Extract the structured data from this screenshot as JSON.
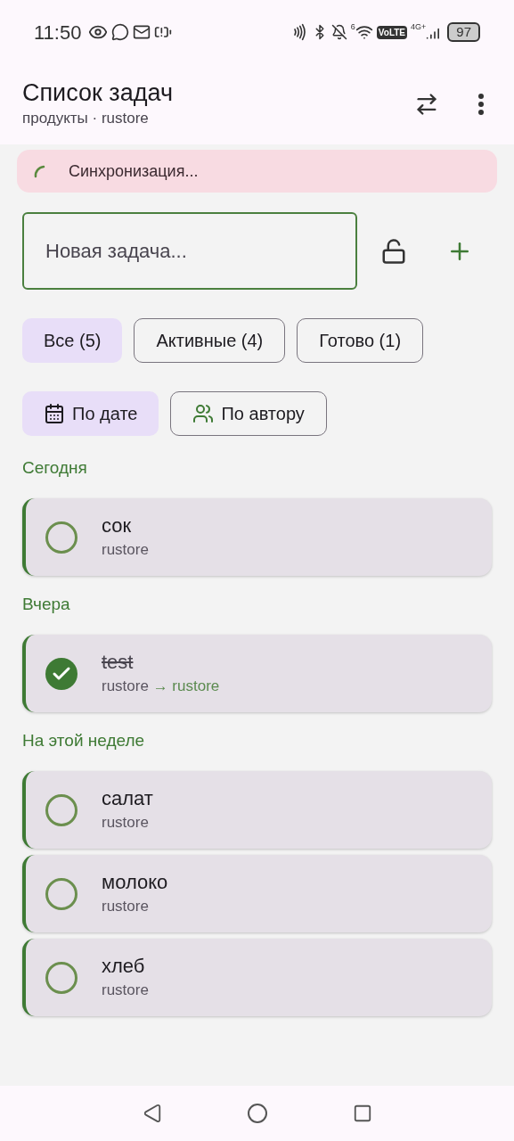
{
  "status_bar": {
    "time": "11:50",
    "wifi_label": "6",
    "volte": "VoLTE",
    "network": "4G+",
    "battery": "97"
  },
  "header": {
    "title": "Список задач",
    "subtitle": "продукты · rustore"
  },
  "sync_banner": {
    "text": "Синхронизация..."
  },
  "new_task": {
    "placeholder": "Новая задача...",
    "locked": false
  },
  "filters": [
    {
      "label": "Все (5)",
      "selected": true
    },
    {
      "label": "Активные (4)",
      "selected": false
    },
    {
      "label": "Готово (1)",
      "selected": false
    }
  ],
  "sort": [
    {
      "label": "По дате",
      "kind": "date",
      "selected": true
    },
    {
      "label": "По автору",
      "kind": "author",
      "selected": false
    }
  ],
  "groups": [
    {
      "title": "Сегодня",
      "tasks": [
        {
          "title": "сок",
          "author": "rustore",
          "checked": false
        }
      ]
    },
    {
      "title": "Вчера",
      "tasks": [
        {
          "title": "test",
          "author": "rustore",
          "assignee": "→ rustore",
          "checked": true
        }
      ]
    },
    {
      "title": "На этой неделе",
      "tasks": [
        {
          "title": "салат",
          "author": "rustore",
          "checked": false
        },
        {
          "title": "молоко",
          "author": "rustore",
          "checked": false
        },
        {
          "title": "хлеб",
          "author": "rustore",
          "checked": false
        }
      ]
    }
  ]
}
